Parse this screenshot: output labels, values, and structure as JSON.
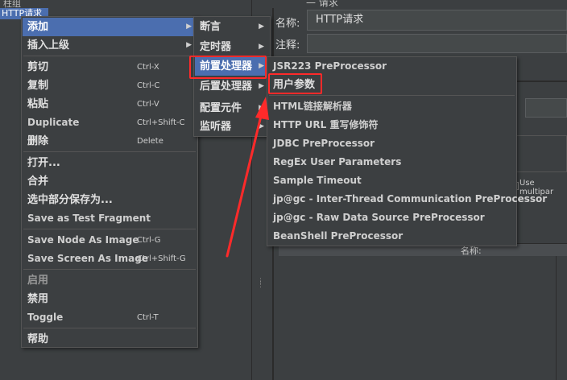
{
  "tree": {
    "top_item": "柱组",
    "selected_item": "HTTP请求"
  },
  "editor": {
    "title": "— 请求",
    "name_label": "名称:",
    "name_value": "HTTP请求",
    "comment_label": "注释:",
    "multipart_label": "Use multipar",
    "table_header_name": "名称:"
  },
  "context_menu": {
    "items": [
      {
        "label": "添加",
        "shortcut": ""
      },
      {
        "label": "插入上级",
        "shortcut": ""
      },
      {
        "label": "剪切",
        "shortcut": "Ctrl-X"
      },
      {
        "label": "复制",
        "shortcut": "Ctrl-C"
      },
      {
        "label": "粘贴",
        "shortcut": "Ctrl-V"
      },
      {
        "label": "Duplicate",
        "shortcut": "Ctrl+Shift-C"
      },
      {
        "label": "删除",
        "shortcut": "Delete"
      },
      {
        "label": "打开...",
        "shortcut": ""
      },
      {
        "label": "合并",
        "shortcut": ""
      },
      {
        "label": "选中部分保存为...",
        "shortcut": ""
      },
      {
        "label": "Save as Test Fragment",
        "shortcut": ""
      },
      {
        "label": "Save Node As Image",
        "shortcut": "Ctrl-G"
      },
      {
        "label": "Save Screen As Image",
        "shortcut": "Ctrl+Shift-G"
      },
      {
        "label": "启用",
        "shortcut": ""
      },
      {
        "label": "禁用",
        "shortcut": ""
      },
      {
        "label": "Toggle",
        "shortcut": "Ctrl-T"
      },
      {
        "label": "帮助",
        "shortcut": ""
      }
    ]
  },
  "add_submenu": {
    "items": [
      "断言",
      "定时器",
      "前置处理器",
      "后置处理器",
      "配置元件",
      "监听器"
    ]
  },
  "preprocessor_submenu": {
    "items": [
      "JSR223 PreProcessor",
      "用户参数",
      "HTML链接解析器",
      "HTTP URL 重写修饰符",
      "JDBC PreProcessor",
      "RegEx User Parameters",
      "Sample Timeout",
      "jp@gc - Inter-Thread Communication PreProcessor",
      "jp@gc - Raw Data Source PreProcessor",
      "BeanShell PreProcessor"
    ]
  },
  "colors": {
    "highlight": "#4b6eaf",
    "annotation_red": "#ff2a2a",
    "background": "#3c3f41"
  },
  "icons": {
    "submenu_arrow": "▶"
  }
}
